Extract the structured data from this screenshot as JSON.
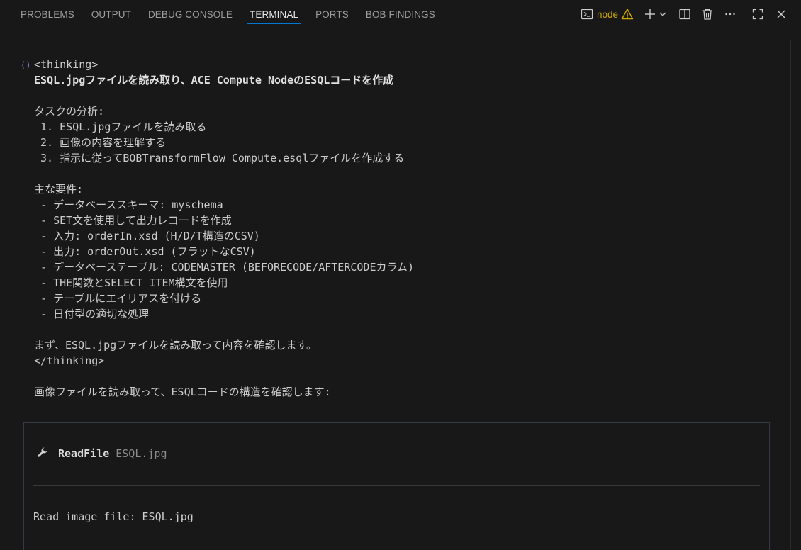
{
  "panel": {
    "tabs": [
      {
        "label": "PROBLEMS",
        "active": false
      },
      {
        "label": "OUTPUT",
        "active": false
      },
      {
        "label": "DEBUG CONSOLE",
        "active": false
      },
      {
        "label": "TERMINAL",
        "active": true
      },
      {
        "label": "PORTS",
        "active": false
      },
      {
        "label": "BOB FINDINGS",
        "active": false
      }
    ],
    "actions": {
      "terminal_name": "node",
      "icons": [
        "terminal-icon",
        "warning-icon",
        "plus-icon",
        "chevron-down-icon",
        "split-icon",
        "trash-icon",
        "more-icon",
        "maximize-icon",
        "close-icon"
      ]
    }
  },
  "terminal": {
    "lines": [
      {
        "text": "<thinking>",
        "bold": false
      },
      {
        "text": "ESQL.jpgファイルを読み取り、ACE Compute NodeのESQLコードを作成",
        "bold": true
      },
      {
        "text": "",
        "bold": false
      },
      {
        "text": "タスクの分析:",
        "bold": false
      },
      {
        "text": " 1. ESQL.jpgファイルを読み取る",
        "bold": false
      },
      {
        "text": " 2. 画像の内容を理解する",
        "bold": false
      },
      {
        "text": " 3. 指示に従ってBOBTransformFlow_Compute.esqlファイルを作成する",
        "bold": false
      },
      {
        "text": "",
        "bold": false
      },
      {
        "text": "主な要件:",
        "bold": false
      },
      {
        "text": " - データベーススキーマ: myschema",
        "bold": false
      },
      {
        "text": " - SET文を使用して出力レコードを作成",
        "bold": false
      },
      {
        "text": " - 入力: orderIn.xsd (H/D/T構造のCSV)",
        "bold": false
      },
      {
        "text": " - 出力: orderOut.xsd (フラットなCSV)",
        "bold": false
      },
      {
        "text": " - データベーステーブル: CODEMASTER (BEFORECODE/AFTERCODEカラム)",
        "bold": false
      },
      {
        "text": " - THE関数とSELECT ITEM構文を使用",
        "bold": false
      },
      {
        "text": " - テーブルにエイリアスを付ける",
        "bold": false
      },
      {
        "text": " - 日付型の適切な処理",
        "bold": false
      },
      {
        "text": "",
        "bold": false
      },
      {
        "text": "まず、ESQL.jpgファイルを読み取って内容を確認します。",
        "bold": false
      },
      {
        "text": "</thinking>",
        "bold": false
      },
      {
        "text": "",
        "bold": false
      },
      {
        "text": "画像ファイルを読み取って、ESQLコードの構造を確認します:",
        "bold": false
      }
    ],
    "tool_call": {
      "icon": "wrench-icon",
      "name": "ReadFile",
      "argument": "ESQL.jpg",
      "result": "Read image file: ESQL.jpg"
    }
  },
  "colors": {
    "background": "#181818",
    "text": "#cccccc",
    "active_tab_underline": "#0078d4",
    "warning": "#cca700"
  }
}
